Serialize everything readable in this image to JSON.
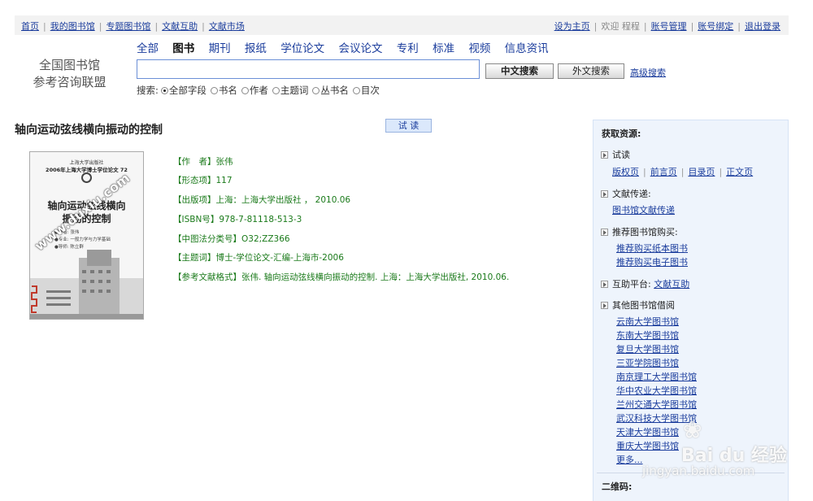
{
  "topbar": {
    "left_links": [
      "首页",
      "我的图书馆",
      "专题图书馆",
      "文献互助",
      "文献市场"
    ],
    "set_home": "设为主页",
    "greeting": "欢迎 程程",
    "right_links": [
      "账号管理",
      "账号绑定",
      "退出登录"
    ]
  },
  "logo": {
    "line1": "全国图书馆",
    "line2": "参考咨询联盟"
  },
  "tabs": [
    {
      "label": "全部",
      "active": false
    },
    {
      "label": "图书",
      "active": true
    },
    {
      "label": "期刊",
      "active": false
    },
    {
      "label": "报纸",
      "active": false
    },
    {
      "label": "学位论文",
      "active": false
    },
    {
      "label": "会议论文",
      "active": false
    },
    {
      "label": "专利",
      "active": false
    },
    {
      "label": "标准",
      "active": false
    },
    {
      "label": "视频",
      "active": false
    },
    {
      "label": "信息资讯",
      "active": false
    }
  ],
  "search": {
    "value": "",
    "btn_cn": "中文搜索",
    "btn_en": "外文搜索",
    "advanced": "高级搜索",
    "fields_label": "搜索:",
    "fields": [
      "全部字段",
      "书名",
      "作者",
      "主题词",
      "丛书名",
      "目次"
    ],
    "selected_field": "全部字段"
  },
  "book": {
    "title": "轴向运动弦线横向振动的控制",
    "try_read": "试 读",
    "cover": {
      "top": "上海大学出版社",
      "series": "2006年上海大学博士学位论文 72",
      "title_line1": "轴向运动弦线横向",
      "title_line2": "振动的控制",
      "meta1": "●作者: 张伟",
      "meta2": "●专业: 一般力学与力学基础",
      "meta3": "●导师: 陈立群",
      "watermark": "www.duxiu.com"
    },
    "details": [
      {
        "label": "【作　者】",
        "value": "张伟"
      },
      {
        "label": "【形态项】",
        "value": "117"
      },
      {
        "label": "【出版项】",
        "value": "上海：上海大学出版社 ， 2010.06"
      },
      {
        "label": "【ISBN号】",
        "value": "978-7-81118-513-3"
      },
      {
        "label": "【中图法分类号】",
        "value": "O32;ZZ366"
      },
      {
        "label": "【主题词】",
        "value": "博士-学位论文-汇编-上海市-2006"
      },
      {
        "label": "【参考文献格式】",
        "value": "张伟. 轴向运动弦线横向振动的控制. 上海：上海大学出版社, 2010.06."
      }
    ]
  },
  "panel": {
    "title": "获取资源:",
    "try_label": "试读",
    "try_links": [
      "版权页",
      "前言页",
      "目录页",
      "正文页"
    ],
    "delivery_label": "文献传递:",
    "delivery_link": "图书馆文献传递",
    "recommend_label": "推荐图书馆购买:",
    "recommend_links": [
      "推荐购买纸本图书",
      "推荐购买电子图书"
    ],
    "mutual_label": "互助平台:",
    "mutual_link": "文献互助",
    "other_label": "其他图书馆借阅",
    "libraries": [
      "云南大学图书馆",
      "东南大学图书馆",
      "复旦大学图书馆",
      "三亚学院图书馆",
      "南京理工大学图书馆",
      "华中农业大学图书馆",
      "兰州交通大学图书馆",
      "武汉科技大学图书馆",
      "天津大学图书馆",
      "重庆大学图书馆",
      "更多..."
    ],
    "qrcode_label": "二维码:"
  },
  "watermark": {
    "brand": "Bai du 经验",
    "url": "jingyan.baidu.com"
  }
}
